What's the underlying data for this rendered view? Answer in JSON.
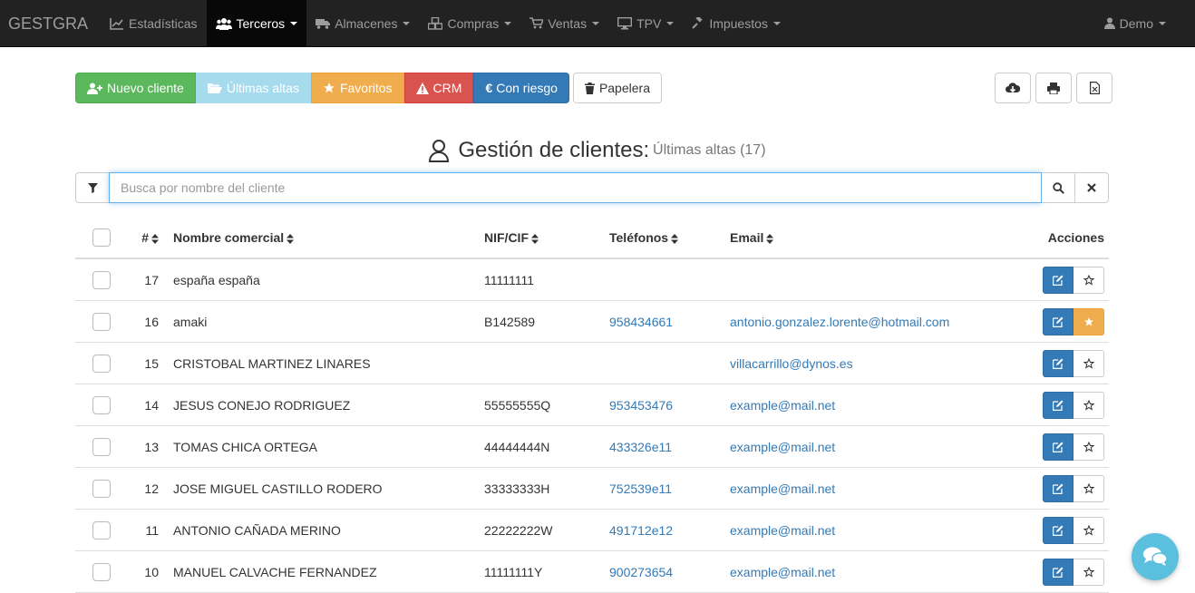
{
  "navbar": {
    "brand": "GESTGRA",
    "items": [
      {
        "label": "Estadísticas",
        "icon": "chart-line-icon",
        "dropdown": false
      },
      {
        "label": "Terceros",
        "icon": "users-icon",
        "dropdown": true,
        "active": true
      },
      {
        "label": "Almacenes",
        "icon": "truck-icon",
        "dropdown": true
      },
      {
        "label": "Compras",
        "icon": "cubes-icon",
        "dropdown": true
      },
      {
        "label": "Ventas",
        "icon": "cart-icon",
        "dropdown": true
      },
      {
        "label": "TPV",
        "icon": "monitor-icon",
        "dropdown": true
      },
      {
        "label": "Impuestos",
        "icon": "gavel-icon",
        "dropdown": true
      }
    ],
    "user": "Demo"
  },
  "toolbar": {
    "new_client": "Nuevo cliente",
    "latest": "Últimas altas",
    "favorites": "Favoritos",
    "crm": "CRM",
    "risk": "Con riesgo",
    "trash": "Papelera"
  },
  "title": {
    "main": "Gestión de clientes:",
    "sub": "Últimas altas (17)"
  },
  "search": {
    "placeholder": "Busca por nombre del cliente",
    "value": ""
  },
  "table": {
    "columns": {
      "num": "#",
      "name": "Nombre comercial",
      "nif": "NIF/CIF",
      "phones": "Teléfonos",
      "email": "Email",
      "actions": "Acciones"
    },
    "rows": [
      {
        "num": "17",
        "name": "españa españa",
        "nif": "11111111",
        "phone": "",
        "email": "",
        "favorite": false
      },
      {
        "num": "16",
        "name": "amaki",
        "nif": "B142589",
        "phone": "958434661",
        "email": "antonio.gonzalez.lorente@hotmail.com",
        "favorite": true
      },
      {
        "num": "15",
        "name": "CRISTOBAL MARTINEZ LINARES",
        "nif": "",
        "phone": "",
        "email": "villacarrillo@dynos.es",
        "favorite": false
      },
      {
        "num": "14",
        "name": "JESUS CONEJO RODRIGUEZ",
        "nif": "55555555Q",
        "phone": "953453476",
        "email": "example@mail.net",
        "favorite": false
      },
      {
        "num": "13",
        "name": "TOMAS CHICA ORTEGA",
        "nif": "44444444N",
        "phone": "433326e11",
        "email": "example@mail.net",
        "favorite": false
      },
      {
        "num": "12",
        "name": "JOSE MIGUEL CASTILLO RODERO",
        "nif": "33333333H",
        "phone": "752539e11",
        "email": "example@mail.net",
        "favorite": false
      },
      {
        "num": "11",
        "name": "ANTONIO CAÑADA MERINO",
        "nif": "22222222W",
        "phone": "491712e12",
        "email": "example@mail.net",
        "favorite": false
      },
      {
        "num": "10",
        "name": "MANUEL CALVACHE FERNANDEZ",
        "nif": "11111111Y",
        "phone": "900273654",
        "email": "example@mail.net",
        "favorite": false
      }
    ]
  },
  "colors": {
    "navbar": "#222222",
    "primary": "#337ab7",
    "success": "#5cb85c",
    "info": "#a6dbee",
    "warning": "#f0ad4e",
    "danger": "#d9534f",
    "chat": "#5bc0de"
  }
}
